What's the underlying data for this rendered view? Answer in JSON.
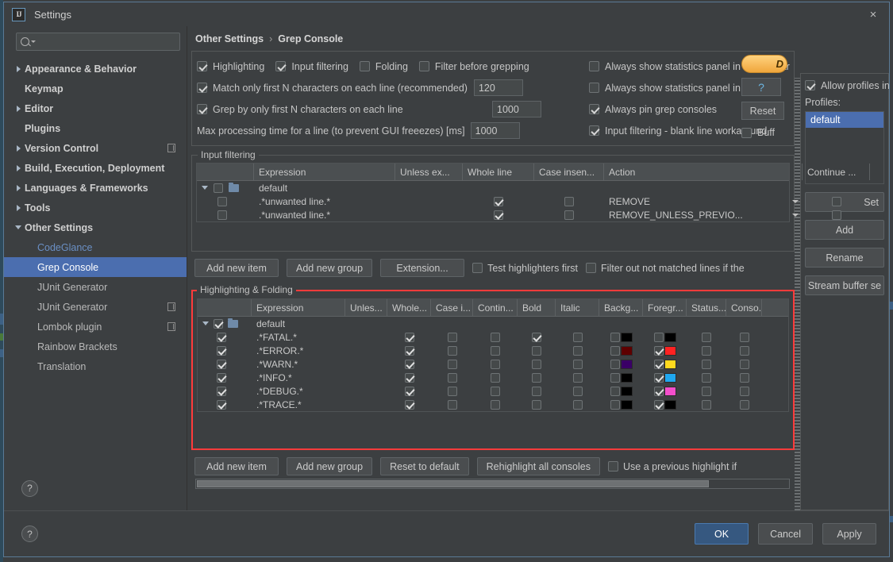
{
  "window": {
    "title": "Settings",
    "logo_text": "IJ",
    "close_icon": "×"
  },
  "search": {
    "value": "",
    "placeholder": ""
  },
  "sidebar": {
    "items": [
      {
        "label": "Appearance & Behavior",
        "expandable": true,
        "expanded": false,
        "child": false,
        "selected": false,
        "plugin": false
      },
      {
        "label": "Keymap",
        "expandable": false,
        "expanded": false,
        "child": false,
        "selected": false,
        "plugin": false
      },
      {
        "label": "Editor",
        "expandable": true,
        "expanded": false,
        "child": false,
        "selected": false,
        "plugin": false
      },
      {
        "label": "Plugins",
        "expandable": false,
        "expanded": false,
        "child": false,
        "selected": false,
        "plugin": false
      },
      {
        "label": "Version Control",
        "expandable": true,
        "expanded": false,
        "child": false,
        "selected": false,
        "plugin": true
      },
      {
        "label": "Build, Execution, Deployment",
        "expandable": true,
        "expanded": false,
        "child": false,
        "selected": false,
        "plugin": false
      },
      {
        "label": "Languages & Frameworks",
        "expandable": true,
        "expanded": false,
        "child": false,
        "selected": false,
        "plugin": false
      },
      {
        "label": "Tools",
        "expandable": true,
        "expanded": false,
        "child": false,
        "selected": false,
        "plugin": false
      },
      {
        "label": "Other Settings",
        "expandable": true,
        "expanded": true,
        "child": false,
        "selected": false,
        "plugin": false
      },
      {
        "label": "CodeGlance",
        "expandable": false,
        "expanded": false,
        "child": true,
        "selected": false,
        "plugin": false,
        "link": true
      },
      {
        "label": "Grep Console",
        "expandable": false,
        "expanded": false,
        "child": true,
        "selected": true,
        "plugin": false
      },
      {
        "label": "JUnit Generator",
        "expandable": false,
        "expanded": false,
        "child": true,
        "selected": false,
        "plugin": false
      },
      {
        "label": "JUnit Generator",
        "expandable": false,
        "expanded": false,
        "child": true,
        "selected": false,
        "plugin": true
      },
      {
        "label": "Lombok plugin",
        "expandable": false,
        "expanded": false,
        "child": true,
        "selected": false,
        "plugin": true
      },
      {
        "label": "Rainbow Brackets",
        "expandable": false,
        "expanded": false,
        "child": true,
        "selected": false,
        "plugin": false
      },
      {
        "label": "Translation",
        "expandable": false,
        "expanded": false,
        "child": true,
        "selected": false,
        "plugin": false
      }
    ],
    "help_icon": "?"
  },
  "breadcrumb": {
    "parent": "Other Settings",
    "separator": "›",
    "current": "Grep Console"
  },
  "options": {
    "row1": [
      {
        "label": "Highlighting",
        "checked": true
      },
      {
        "label": "Input filtering",
        "checked": true
      },
      {
        "label": "Folding",
        "checked": false
      },
      {
        "label": "Filter before grepping",
        "checked": false
      }
    ],
    "match_first_n": {
      "label": "Match only first N characters on each line (recommended)",
      "checked": true,
      "value": "120"
    },
    "grep_first_n": {
      "label": "Grep by only first N characters on each line",
      "checked": true,
      "value": "1000"
    },
    "max_processing": {
      "label": "Max processing time for a line (to prevent GUI freeezes) [ms]",
      "value": "1000"
    },
    "right": [
      {
        "label": "Always show statistics panel in Status Bar",
        "checked": false
      },
      {
        "label": "Always show statistics panel in Console",
        "checked": false
      },
      {
        "label": "Always pin grep consoles",
        "checked": true
      },
      {
        "label": "Input filtering - blank line workaround",
        "checked": true
      }
    ],
    "donate_label": "D",
    "question_label": "?",
    "reset_label": "Reset",
    "buffer_label": "Buff",
    "buffer_checked": false
  },
  "input_filtering": {
    "title": "Input filtering",
    "columns": [
      "Expression",
      "Unless ex...",
      "Whole line",
      "Case insen...",
      "Action",
      "Continue ..."
    ],
    "rows": [
      {
        "kind": "group",
        "expanded": true,
        "enabled": false,
        "expression": "default",
        "unless": "",
        "whole": null,
        "case": null,
        "action": "",
        "continue": null
      },
      {
        "kind": "item",
        "enabled": false,
        "expression": ".*unwanted line.*",
        "unless": "",
        "whole": true,
        "case": false,
        "action": "REMOVE",
        "continue": false
      },
      {
        "kind": "item",
        "enabled": false,
        "expression": ".*unwanted line.*",
        "unless": "",
        "whole": true,
        "case": false,
        "action": "REMOVE_UNLESS_PREVIO...",
        "continue": false
      }
    ],
    "buttons": [
      "Add new item",
      "Add new group",
      "Extension..."
    ],
    "checkboxes": [
      {
        "label": "Test highlighters first",
        "checked": false
      },
      {
        "label": "Filter out not matched lines if the",
        "checked": false
      }
    ]
  },
  "highlighting": {
    "title": "Highlighting & Folding",
    "columns": [
      "Expression",
      "Unles...",
      "Whole...",
      "Case i...",
      "Contin...",
      "Bold",
      "Italic",
      "Backg...",
      "Foregr...",
      "Status...",
      "Conso..."
    ],
    "rows": [
      {
        "kind": "group",
        "expanded": true,
        "enabled": true,
        "expression": "default",
        "unless": null,
        "whole": null,
        "case": null,
        "continue": null,
        "bold": null,
        "italic": null,
        "bg": null,
        "bg_color": null,
        "fg": null,
        "fg_color": null,
        "status": null,
        "console": null
      },
      {
        "kind": "item",
        "enabled": true,
        "expression": ".*FATAL.*",
        "unless": "",
        "whole": true,
        "case": false,
        "continue": false,
        "bold": true,
        "italic": false,
        "bg": false,
        "bg_color": "#000000",
        "fg": false,
        "fg_color": "#000000",
        "status": false,
        "console": false
      },
      {
        "kind": "item",
        "enabled": true,
        "expression": ".*ERROR.*",
        "unless": "",
        "whole": true,
        "case": false,
        "continue": false,
        "bold": false,
        "italic": false,
        "bg": false,
        "bg_color": "#5e0000",
        "fg": true,
        "fg_color": "#ff2222",
        "status": false,
        "console": false
      },
      {
        "kind": "item",
        "enabled": true,
        "expression": ".*WARN.*",
        "unless": "",
        "whole": true,
        "case": false,
        "continue": false,
        "bold": false,
        "italic": false,
        "bg": false,
        "bg_color": "#3a0066",
        "fg": true,
        "fg_color": "#ffd91e",
        "status": false,
        "console": false
      },
      {
        "kind": "item",
        "enabled": true,
        "expression": ".*INFO.*",
        "unless": "",
        "whole": true,
        "case": false,
        "continue": false,
        "bold": false,
        "italic": false,
        "bg": false,
        "bg_color": "#000000",
        "fg": true,
        "fg_color": "#1fa7ef",
        "status": false,
        "console": false
      },
      {
        "kind": "item",
        "enabled": true,
        "expression": ".*DEBUG.*",
        "unless": "",
        "whole": true,
        "case": false,
        "continue": false,
        "bold": false,
        "italic": false,
        "bg": false,
        "bg_color": "#000000",
        "fg": true,
        "fg_color": "#f34ecb",
        "status": false,
        "console": false
      },
      {
        "kind": "item",
        "enabled": true,
        "expression": ".*TRACE.*",
        "unless": "",
        "whole": true,
        "case": false,
        "continue": false,
        "bold": false,
        "italic": false,
        "bg": false,
        "bg_color": "#000000",
        "fg": true,
        "fg_color": "#000000",
        "status": false,
        "console": false
      }
    ],
    "buttons": [
      "Add new item",
      "Add new group",
      "Reset to default",
      "Rehighlight all consoles"
    ],
    "checkbox": {
      "label": "Use a previous highlight if",
      "checked": false
    }
  },
  "profiles": {
    "allow_label": "Allow profiles in",
    "allow_checked": true,
    "list_label": "Profiles:",
    "items": [
      {
        "label": "default",
        "selected": true
      }
    ],
    "buttons": [
      "Set",
      "Add",
      "Rename",
      "Stream buffer se"
    ]
  },
  "footer": {
    "help_icon": "?",
    "ok": "OK",
    "cancel": "Cancel",
    "apply": "Apply",
    "apply_mnemonic": "A"
  }
}
